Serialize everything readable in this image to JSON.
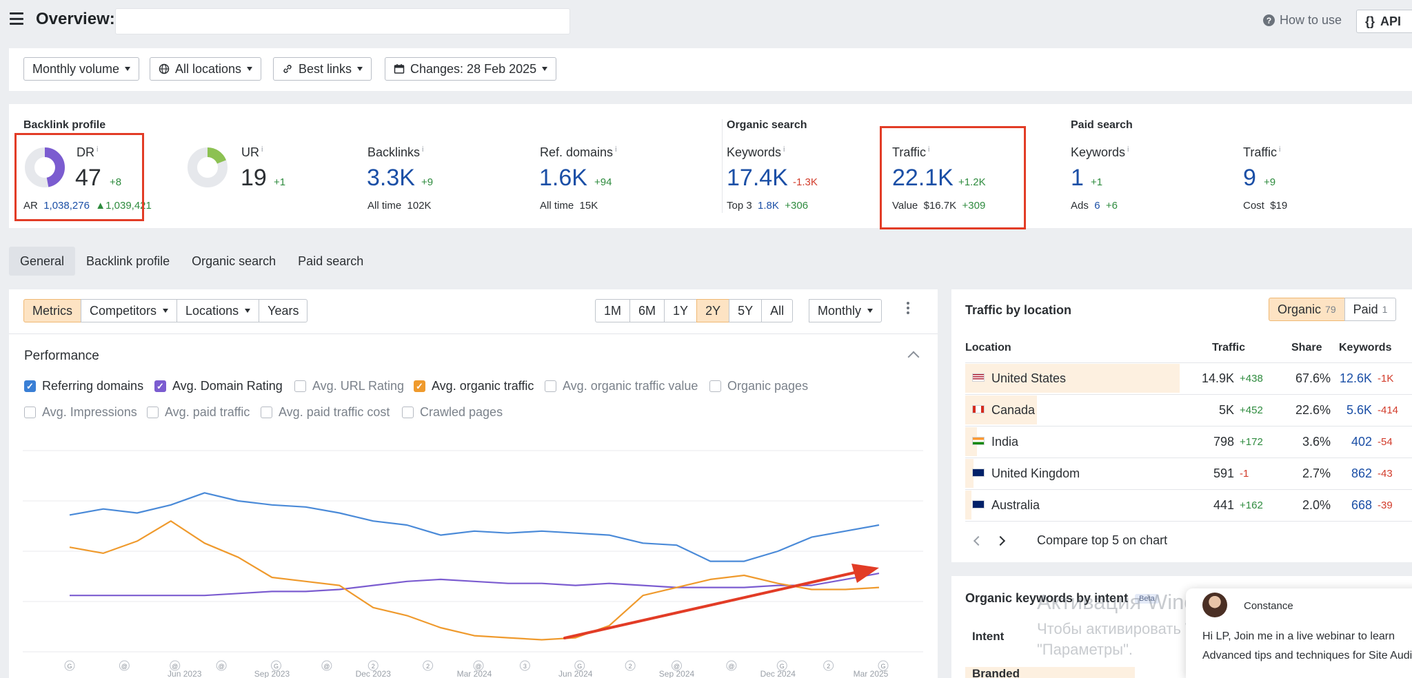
{
  "header": {
    "title": "Overview:",
    "target_value": "",
    "how_to_use": "How to use",
    "api_label": "API",
    "api_icon": "{}"
  },
  "filters": {
    "volume": "Monthly volume",
    "locations": "All locations",
    "links": "Best links",
    "changes": "Changes: 28 Feb 2025"
  },
  "backlink_profile": {
    "title": "Backlink profile",
    "dr": {
      "label": "DR",
      "value": "47",
      "delta": "+8",
      "ar_label": "AR",
      "ar_value": "1,038,276",
      "ar_delta": "1,039,421",
      "donut_fraction": 0.47
    },
    "ur": {
      "label": "UR",
      "value": "19",
      "delta": "+1",
      "donut_fraction": 0.19
    },
    "backlinks": {
      "label": "Backlinks",
      "value": "3.3K",
      "delta": "+9",
      "sub_label": "All time",
      "sub_value": "102K"
    },
    "ref_domains": {
      "label": "Ref. domains",
      "value": "1.6K",
      "delta": "+94",
      "sub_label": "All time",
      "sub_value": "15K"
    }
  },
  "organic_search": {
    "title": "Organic search",
    "keywords": {
      "label": "Keywords",
      "value": "17.4K",
      "delta": "-1.3K",
      "sub_label": "Top 3",
      "sub_value": "1.8K",
      "sub_delta": "+306"
    },
    "traffic": {
      "label": "Traffic",
      "value": "22.1K",
      "delta": "+1.2K",
      "sub_label": "Value",
      "sub_value": "$16.7K",
      "sub_delta": "+309"
    }
  },
  "paid_search": {
    "title": "Paid search",
    "keywords": {
      "label": "Keywords",
      "value": "1",
      "delta": "+1",
      "sub_label": "Ads",
      "sub_value": "6",
      "sub_delta": "+6"
    },
    "traffic": {
      "label": "Traffic",
      "value": "9",
      "delta": "+9",
      "sub_label": "Cost",
      "sub_value": "$19"
    }
  },
  "tabs": [
    "General",
    "Backlink profile",
    "Organic search",
    "Paid search"
  ],
  "chart_toolbar": {
    "views": [
      "Metrics",
      "Competitors",
      "Locations",
      "Years"
    ],
    "ranges": [
      "1M",
      "6M",
      "1Y",
      "2Y",
      "5Y",
      "All"
    ],
    "selected_range": "2Y",
    "granularity": "Monthly"
  },
  "performance": {
    "title": "Performance",
    "checkboxes": [
      {
        "label": "Referring domains",
        "checked": true,
        "color": "#3a7fd5"
      },
      {
        "label": "Avg. Domain Rating",
        "checked": true,
        "color": "#7b5cd0"
      },
      {
        "label": "Avg. URL Rating",
        "checked": false
      },
      {
        "label": "Avg. organic traffic",
        "checked": true,
        "color": "#ef9a2d"
      },
      {
        "label": "Avg. organic traffic value",
        "checked": false
      },
      {
        "label": "Organic pages",
        "checked": false
      },
      {
        "label": "Avg. Impressions",
        "checked": false
      },
      {
        "label": "Avg. paid traffic",
        "checked": false
      },
      {
        "label": "Avg. paid traffic cost",
        "checked": false
      },
      {
        "label": "Crawled pages",
        "checked": false
      }
    ]
  },
  "chart_data": {
    "type": "line",
    "x_tick_labels": [
      "Jun 2023",
      "Sep 2023",
      "Dec 2023",
      "Mar 2024",
      "Jun 2024",
      "Sep 2024",
      "Dec 2024",
      "Mar 2025"
    ],
    "x_points": 25,
    "grid": true,
    "y_axis_labels_shown": false,
    "series": [
      {
        "name": "Referring domains",
        "color": "#4a8ad8",
        "values": [
          0.68,
          0.71,
          0.69,
          0.73,
          0.79,
          0.75,
          0.73,
          0.72,
          0.69,
          0.65,
          0.63,
          0.58,
          0.6,
          0.59,
          0.6,
          0.59,
          0.58,
          0.54,
          0.53,
          0.45,
          0.45,
          0.5,
          0.57,
          0.6,
          0.63
        ]
      },
      {
        "name": "Avg. Domain Rating",
        "color": "#7b5cd0",
        "values": [
          0.28,
          0.28,
          0.28,
          0.28,
          0.28,
          0.29,
          0.3,
          0.3,
          0.31,
          0.33,
          0.35,
          0.36,
          0.35,
          0.34,
          0.34,
          0.33,
          0.34,
          0.33,
          0.32,
          0.32,
          0.32,
          0.33,
          0.33,
          0.36,
          0.39
        ]
      },
      {
        "name": "Avg. organic traffic",
        "color": "#ef9a2d",
        "values": [
          0.52,
          0.49,
          0.55,
          0.65,
          0.54,
          0.47,
          0.37,
          0.35,
          0.33,
          0.22,
          0.18,
          0.12,
          0.08,
          0.07,
          0.06,
          0.07,
          0.13,
          0.28,
          0.32,
          0.36,
          0.38,
          0.34,
          0.31,
          0.31,
          0.32
        ]
      }
    ],
    "annotation_markers": [
      "G",
      "@",
      "@",
      "@",
      "G",
      "@",
      "2",
      "2",
      "@",
      "3",
      "G",
      "2",
      "@",
      "@",
      "G",
      "2",
      "G"
    ]
  },
  "traffic_by_location": {
    "title": "Traffic by location",
    "organic_label": "Organic",
    "organic_count": "79",
    "paid_label": "Paid",
    "paid_count": "1",
    "headers": [
      "Location",
      "Traffic",
      "Share",
      "Keywords"
    ],
    "rows": [
      {
        "country": "United States",
        "traffic": "14.9K",
        "traffic_delta": "+438",
        "share": "67.6%",
        "keywords": "12.6K",
        "kw_delta": "-1K",
        "share_fraction": 0.676,
        "flag": "us-flag"
      },
      {
        "country": "Canada",
        "traffic": "5K",
        "traffic_delta": "+452",
        "share": "22.6%",
        "keywords": "5.6K",
        "kw_delta": "-414",
        "share_fraction": 0.226,
        "flag": "ca-flag"
      },
      {
        "country": "India",
        "traffic": "798",
        "traffic_delta": "+172",
        "share": "3.6%",
        "keywords": "402",
        "kw_delta": "-54",
        "share_fraction": 0.036,
        "flag": "in-flag"
      },
      {
        "country": "United Kingdom",
        "traffic": "591",
        "traffic_delta": "-1",
        "share": "2.7%",
        "keywords": "862",
        "kw_delta": "-43",
        "share_fraction": 0.027,
        "flag": "gb-flag"
      },
      {
        "country": "Australia",
        "traffic": "441",
        "traffic_delta": "+162",
        "share": "2.0%",
        "keywords": "668",
        "kw_delta": "-39",
        "share_fraction": 0.02,
        "flag": "au-flag"
      }
    ],
    "compare_label": "Compare top 5 on chart"
  },
  "intent_panel": {
    "title": "Organic keywords by intent",
    "beta": "Beta",
    "intent_header": "Intent",
    "first_row": "Branded"
  },
  "watermark": {
    "line1": "Активация Windows",
    "line2": "Чтобы активировать Windows, перейдите в раздел",
    "line3": "\"Параметры\"."
  },
  "chat_popup": {
    "name": "Constance",
    "line1": "Hi LP, Join me in a live webinar to learn",
    "line2": "Advanced tips and techniques for Site Audit"
  },
  "colors": {
    "accent_blue": "#1b4fa6",
    "positive": "#2e8b3e",
    "negative": "#d23b2a",
    "highlight_red": "#e23c26",
    "selected_bg": "#fde3c3"
  }
}
